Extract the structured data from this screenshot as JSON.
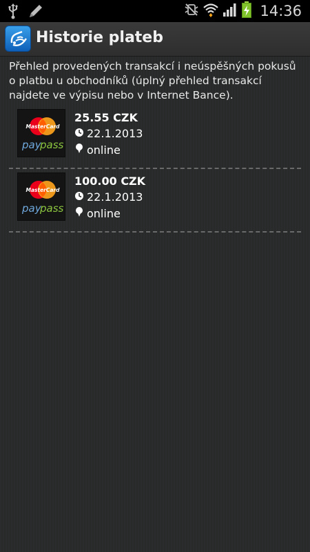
{
  "status_bar": {
    "time": "14:36",
    "icons": [
      "usb-icon",
      "edit-icon",
      "mute-icon",
      "wifi-icon",
      "signal-icon",
      "battery-charging-icon"
    ]
  },
  "action_bar": {
    "title": "Historie plateb",
    "app_icon": "nfc-payment-icon"
  },
  "intro_text": "Přehled provedených transakcí i neúspěšných pokusů o platbu u obchodníků (úplný přehled transakcí najdete ve výpisu nebo v Internet Bance).",
  "transactions": [
    {
      "amount": "25.55 CZK",
      "date": "22.1.2013",
      "channel": "online",
      "logo": {
        "brand": "MasterCard",
        "product_a": "pay",
        "product_b": "pass"
      }
    },
    {
      "amount": "100.00 CZK",
      "date": "22.1.2013",
      "channel": "online",
      "logo": {
        "brand": "MasterCard",
        "product_a": "pay",
        "product_b": "pass"
      }
    }
  ],
  "colors": {
    "background": "#2b2c2d",
    "status_bar": "#000000",
    "mastercard_red": "#eb001b",
    "mastercard_orange": "#f79e1b",
    "paypass_blue": "#6fa8dc",
    "paypass_green": "#8cc63f"
  }
}
